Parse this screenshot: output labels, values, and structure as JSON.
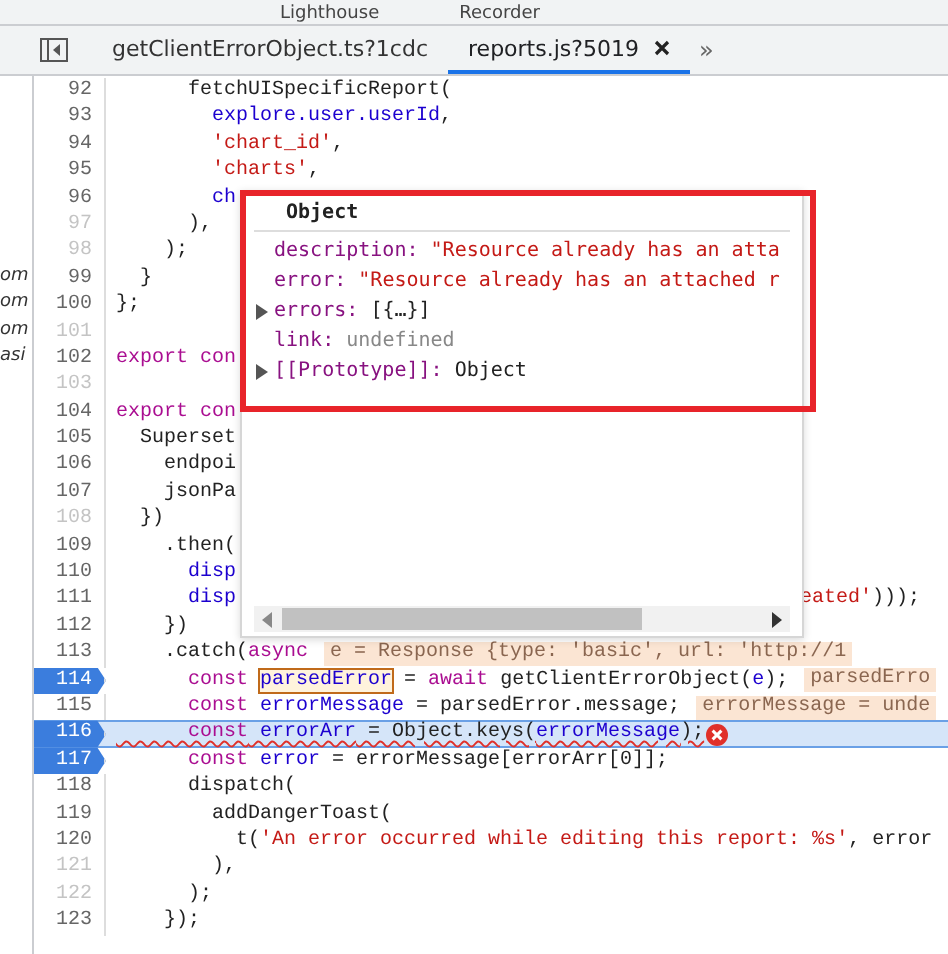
{
  "panel_tabs": [
    {
      "label": "Lighthouse"
    },
    {
      "label": "Recorder"
    }
  ],
  "editor_tabs": [
    {
      "label": "getClientErrorObject.ts?1cdc",
      "selected": false,
      "closable": false
    },
    {
      "label": "reports.js?5019",
      "selected": true,
      "closable": true
    }
  ],
  "more_tabs": "»",
  "navigator_fragments": [
    "om",
    "om",
    "om",
    "asi"
  ],
  "lines": [
    {
      "number": "92",
      "breakable": true,
      "breakpoint": false,
      "current": false,
      "error": false,
      "tokens": [
        {
          "text": "      fetchUISpecificReport(",
          "kind": "plain"
        }
      ]
    },
    {
      "number": "93",
      "breakable": true,
      "breakpoint": false,
      "current": false,
      "error": false,
      "tokens": [
        {
          "text": "        explore.user.userId",
          "kind": "var"
        },
        {
          "text": ",",
          "kind": "plain"
        }
      ]
    },
    {
      "number": "94",
      "breakable": true,
      "breakpoint": false,
      "current": false,
      "error": false,
      "tokens": [
        {
          "text": "        'chart_id'",
          "kind": "str"
        },
        {
          "text": ",",
          "kind": "plain"
        }
      ]
    },
    {
      "number": "95",
      "breakable": true,
      "breakpoint": false,
      "current": false,
      "error": false,
      "tokens": [
        {
          "text": "        'charts'",
          "kind": "str"
        },
        {
          "text": ",",
          "kind": "plain"
        }
      ]
    },
    {
      "number": "96",
      "breakable": true,
      "breakpoint": false,
      "current": false,
      "error": false,
      "tokens": [
        {
          "text": "        ch",
          "kind": "var"
        }
      ]
    },
    {
      "number": "97",
      "breakable": false,
      "breakpoint": false,
      "current": false,
      "error": false,
      "tokens": [
        {
          "text": "      ),",
          "kind": "plain"
        }
      ]
    },
    {
      "number": "98",
      "breakable": false,
      "breakpoint": false,
      "current": false,
      "error": false,
      "tokens": [
        {
          "text": "    );",
          "kind": "plain"
        }
      ]
    },
    {
      "number": "99",
      "breakable": true,
      "breakpoint": false,
      "current": false,
      "error": false,
      "tokens": [
        {
          "text": "  }",
          "kind": "plain"
        }
      ]
    },
    {
      "number": "100",
      "breakable": true,
      "breakpoint": false,
      "current": false,
      "error": false,
      "tokens": [
        {
          "text": "};",
          "kind": "plain"
        }
      ]
    },
    {
      "number": "101",
      "breakable": false,
      "breakpoint": false,
      "current": false,
      "error": false
    },
    {
      "number": "102",
      "breakable": true,
      "breakpoint": false,
      "current": false,
      "error": false,
      "tokens": [
        {
          "text": "export con",
          "kind": "kw"
        }
      ]
    },
    {
      "number": "103",
      "breakable": false,
      "breakpoint": false,
      "current": false,
      "error": false
    },
    {
      "number": "104",
      "breakable": true,
      "breakpoint": false,
      "current": false,
      "error": false,
      "tokens": [
        {
          "text": "export con",
          "kind": "kw"
        }
      ]
    },
    {
      "number": "105",
      "breakable": true,
      "breakpoint": false,
      "current": false,
      "error": false,
      "tokens": [
        {
          "text": "  Superset",
          "kind": "plain"
        }
      ]
    },
    {
      "number": "106",
      "breakable": true,
      "breakpoint": false,
      "current": false,
      "error": false,
      "tokens": [
        {
          "text": "    endpoi",
          "kind": "plain"
        }
      ]
    },
    {
      "number": "107",
      "breakable": true,
      "breakpoint": false,
      "current": false,
      "error": false,
      "tokens": [
        {
          "text": "    jsonPa",
          "kind": "plain"
        }
      ]
    },
    {
      "number": "108",
      "breakable": false,
      "breakpoint": false,
      "current": false,
      "error": false,
      "tokens": [
        {
          "text": "  })",
          "kind": "plain"
        }
      ]
    },
    {
      "number": "109",
      "breakable": true,
      "breakpoint": false,
      "current": false,
      "error": false,
      "tokens": [
        {
          "text": "    .then(",
          "kind": "plain"
        }
      ]
    },
    {
      "number": "110",
      "breakable": true,
      "breakpoint": false,
      "current": false,
      "error": false,
      "tokens": [
        {
          "text": "      disp",
          "kind": "var"
        }
      ]
    },
    {
      "number": "111",
      "breakable": true,
      "breakpoint": false,
      "current": false,
      "error": false,
      "tokens": [
        {
          "text": "      disp",
          "kind": "var"
        }
      ],
      "tail_tokens": [
        {
          "text": "eated'",
          "kind": "str"
        },
        {
          "text": ")));",
          "kind": "plain"
        }
      ]
    },
    {
      "number": "112",
      "breakable": true,
      "breakpoint": false,
      "current": false,
      "error": false,
      "tokens": [
        {
          "text": "    })",
          "kind": "plain"
        }
      ]
    },
    {
      "number": "113",
      "breakable": true,
      "breakpoint": false,
      "current": false,
      "error": false,
      "tokens": [
        {
          "text": "    .catch(",
          "kind": "plain"
        },
        {
          "text": "async",
          "kind": "kw"
        }
      ],
      "inline_value": "e = Response {type: 'basic', url: 'http://1"
    },
    {
      "number": "114",
      "breakable": true,
      "breakpoint": true,
      "current": false,
      "error": false,
      "tokens": [
        {
          "text": "      const ",
          "kind": "kw"
        },
        {
          "text": "parsedError",
          "kind": "hover"
        },
        {
          "text": " = ",
          "kind": "plain"
        },
        {
          "text": "await",
          "kind": "kw"
        },
        {
          "text": " getClientErrorObject(",
          "kind": "plain"
        },
        {
          "text": "e",
          "kind": "var"
        },
        {
          "text": ");",
          "kind": "plain"
        }
      ],
      "inline_value": "parsedErro"
    },
    {
      "number": "115",
      "breakable": true,
      "breakpoint": false,
      "current": false,
      "error": false,
      "tokens": [
        {
          "text": "      const",
          "kind": "kw"
        },
        {
          "text": " errorMessage",
          "kind": "var"
        },
        {
          "text": " = parsedError.message;",
          "kind": "plain"
        }
      ],
      "inline_value": "errorMessage = unde"
    },
    {
      "number": "116",
      "breakable": true,
      "breakpoint": true,
      "current": true,
      "error": true,
      "tokens": [
        {
          "text": "      const",
          "kind": "kw"
        },
        {
          "text": " errorArr",
          "kind": "var"
        },
        {
          "text": " = Object.keys(",
          "kind": "plain"
        },
        {
          "text": "errorMessage",
          "kind": "var"
        },
        {
          "text": ");",
          "kind": "plain"
        }
      ]
    },
    {
      "number": "117",
      "breakable": true,
      "breakpoint": true,
      "current": false,
      "error": false,
      "tokens": [
        {
          "text": "      const",
          "kind": "kw"
        },
        {
          "text": " error",
          "kind": "var"
        },
        {
          "text": " = errorMessage[errorArr[0]];",
          "kind": "plain"
        }
      ]
    },
    {
      "number": "118",
      "breakable": true,
      "breakpoint": false,
      "current": false,
      "error": false,
      "tokens": [
        {
          "text": "      dispatch(",
          "kind": "plain"
        }
      ]
    },
    {
      "number": "119",
      "breakable": true,
      "breakpoint": false,
      "current": false,
      "error": false,
      "tokens": [
        {
          "text": "        addDangerToast(",
          "kind": "plain"
        }
      ]
    },
    {
      "number": "120",
      "breakable": true,
      "breakpoint": false,
      "current": false,
      "error": false,
      "tokens": [
        {
          "text": "          t(",
          "kind": "plain"
        },
        {
          "text": "'An error occurred while editing this report: %s'",
          "kind": "str"
        },
        {
          "text": ", error",
          "kind": "plain"
        }
      ]
    },
    {
      "number": "121",
      "breakable": false,
      "breakpoint": false,
      "current": false,
      "error": false,
      "tokens": [
        {
          "text": "        ),",
          "kind": "plain"
        }
      ]
    },
    {
      "number": "122",
      "breakable": false,
      "breakpoint": false,
      "current": false,
      "error": false,
      "tokens": [
        {
          "text": "      );",
          "kind": "plain"
        }
      ]
    },
    {
      "number": "123",
      "breakable": true,
      "breakpoint": false,
      "current": false,
      "error": false,
      "tokens": [
        {
          "text": "    });",
          "kind": "plain"
        }
      ]
    }
  ],
  "popover": {
    "title": "Object",
    "rows": [
      {
        "kind": "string",
        "key": "description:",
        "value": "\"Resource already has an atta"
      },
      {
        "kind": "string",
        "key": "error:",
        "value": "\"Resource already has an attached r"
      },
      {
        "kind": "array",
        "expanded": false,
        "key": "errors:",
        "value": "[{…}]"
      },
      {
        "kind": "undefined",
        "key": "link:",
        "value": "undefined"
      },
      {
        "kind": "object",
        "expanded": false,
        "key": "[[Prototype]]:",
        "value": "Object"
      }
    ]
  }
}
